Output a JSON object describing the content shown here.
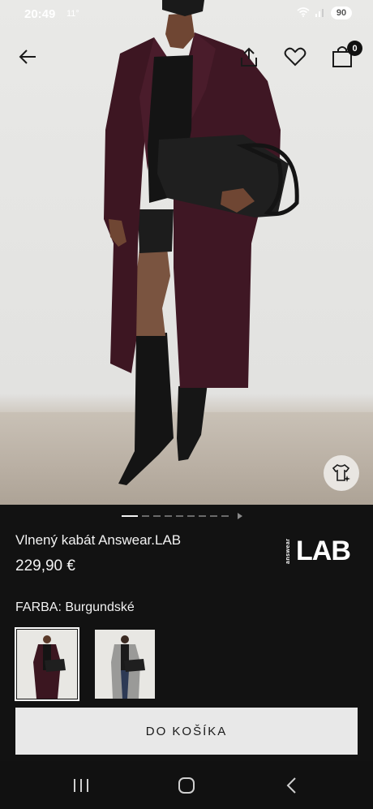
{
  "status_bar": {
    "time": "20:49",
    "temperature": "11°",
    "wifi_icon": "wifi-icon",
    "signal_icon": "signal-icon",
    "battery": "90"
  },
  "nav": {
    "back_icon": "arrow-left-icon",
    "share_icon": "share-icon",
    "wishlist_icon": "heart-icon",
    "cart_icon": "shopping-bag-icon",
    "cart_count": "0"
  },
  "gallery": {
    "slide_count": 7,
    "active_slide": 1,
    "try_on_icon": "tshirt-sparkle-icon"
  },
  "product": {
    "title": "Vlnený kabát Answear.LAB",
    "price": "229,90 €",
    "brand_logo_small": "answear",
    "brand_logo_main": "LAB"
  },
  "color": {
    "label": "FARBA: Burgundské",
    "swatch_colors": [
      "#3b1620",
      "#9a9a98"
    ]
  },
  "cta": {
    "add_to_cart": "DO KOŠÍKA"
  },
  "system_nav": {
    "recent_icon": "recent-apps-icon",
    "home_icon": "home-icon",
    "back_icon": "system-back-icon"
  },
  "colors": {
    "background": "#121212",
    "coat": "#3d1622",
    "button_bg": "#e8e8e8"
  }
}
